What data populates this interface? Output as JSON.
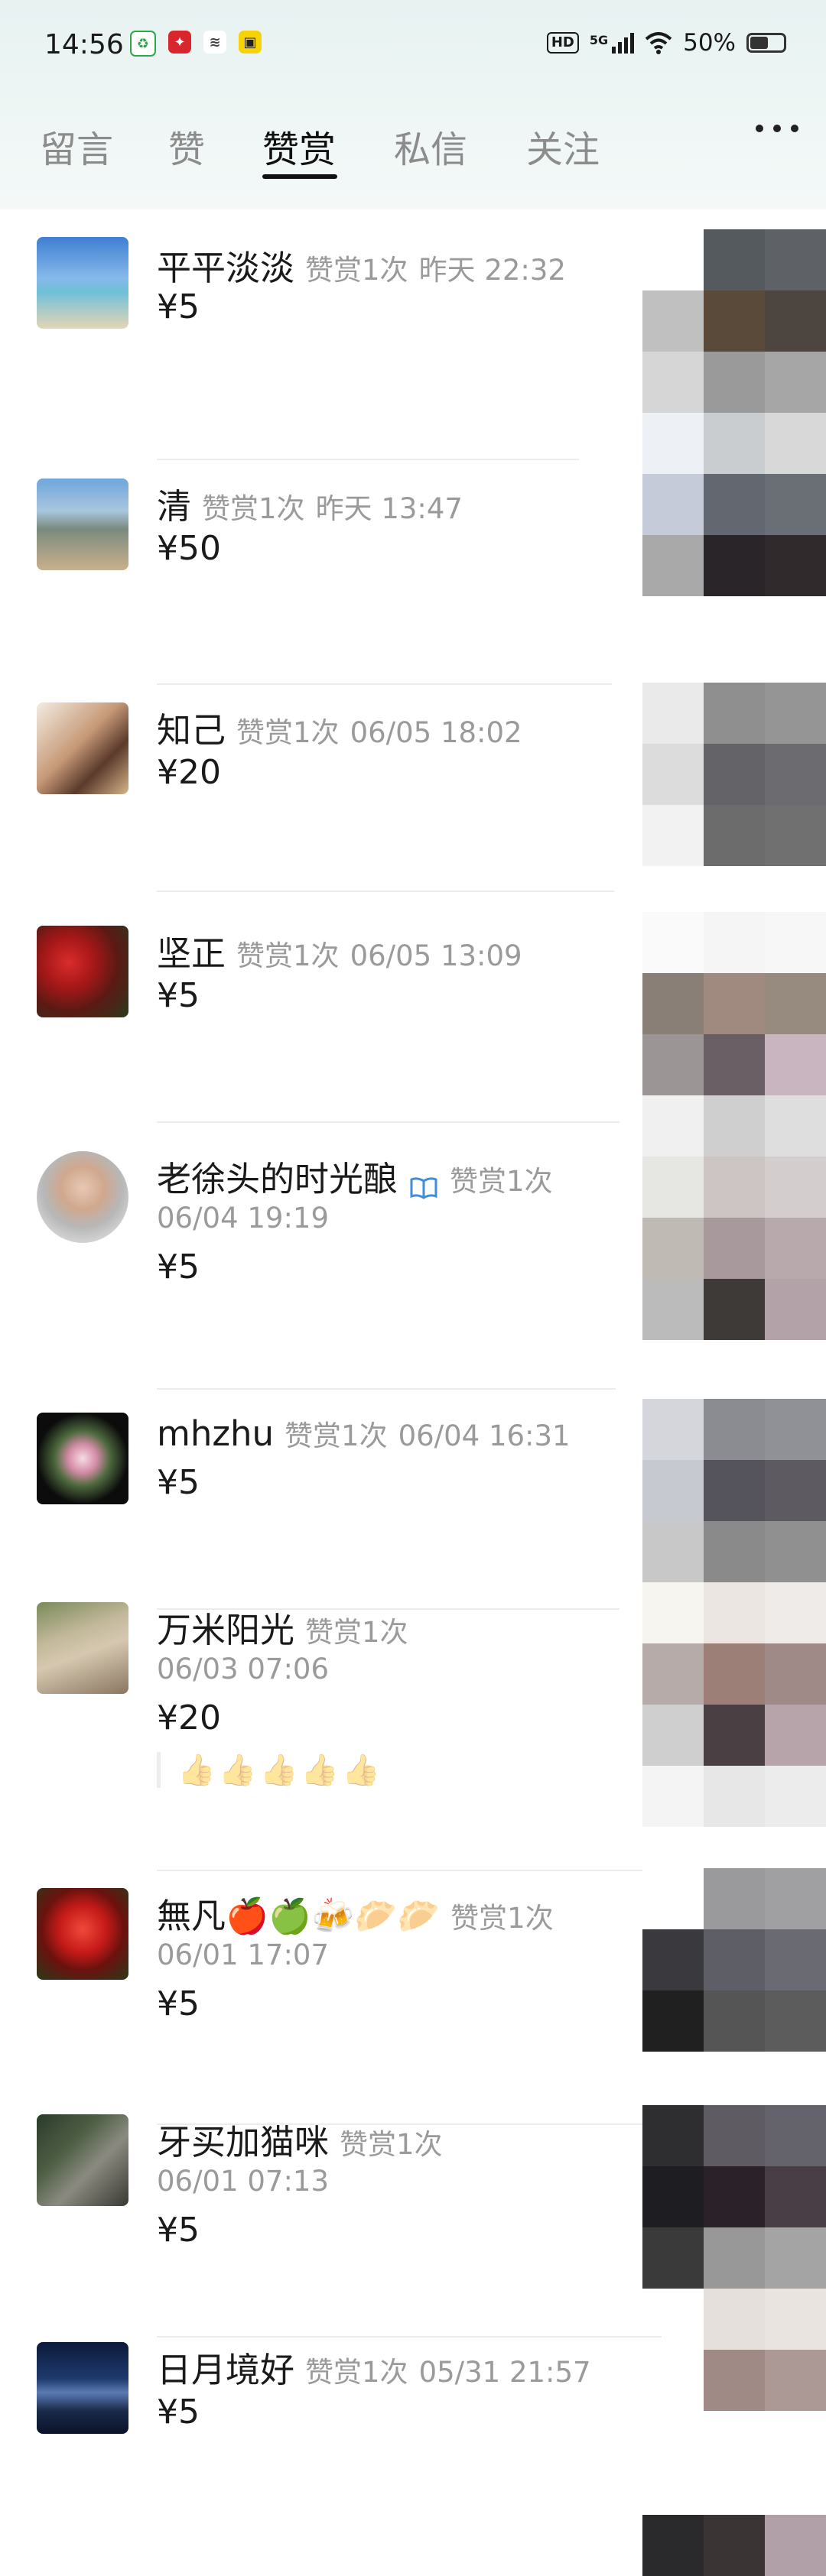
{
  "status_bar": {
    "time": "14:56",
    "apps": [
      "recycle-app-icon",
      "red-app-icon",
      "gray-app-icon",
      "yellow-app-icon"
    ],
    "hd": "HD",
    "network": "5G",
    "battery": "50%",
    "battery_level": 0.5
  },
  "tabs": [
    "留言",
    "赞",
    "赞赏",
    "私信",
    "关注"
  ],
  "active_tab": "赞赏",
  "items": [
    {
      "name": "平平淡淡",
      "count": "赞赏1次",
      "time": "昨天 22:32",
      "amount": "¥5"
    },
    {
      "name": "清",
      "count": "赞赏1次",
      "time": "昨天 13:47",
      "amount": "¥50"
    },
    {
      "name": "知己",
      "count": "赞赏1次",
      "time": "06/05 18:02",
      "amount": "¥20"
    },
    {
      "name": "坚正",
      "count": "赞赏1次",
      "time": "06/05 13:09",
      "amount": "¥5"
    },
    {
      "name": "老徐头的时光酿",
      "count": "赞赏1次",
      "time": "06/04 19:19",
      "amount": "¥5"
    },
    {
      "name": "mhzhu",
      "count": "赞赏1次",
      "time": "06/04 16:31",
      "amount": "¥5"
    },
    {
      "name": "万米阳光",
      "count": "赞赏1次",
      "time": "06/03 07:06",
      "amount": "¥20",
      "message": "👍👍👍👍👍"
    },
    {
      "name": "無凡🍎🍏🍻🥟🥟",
      "count": "赞赏1次",
      "time": "06/01 17:07",
      "amount": "¥5"
    },
    {
      "name": "牙买加猫咪",
      "count": "赞赏1次",
      "time": "06/01 07:13",
      "amount": "¥5"
    },
    {
      "name": "日月境好",
      "count": "赞赏1次",
      "time": "05/31 21:57",
      "amount": "¥5"
    }
  ]
}
